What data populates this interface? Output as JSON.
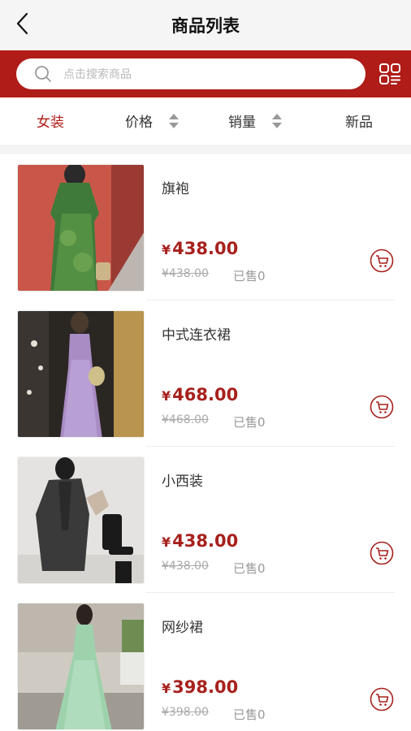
{
  "header": {
    "title": "商品列表",
    "back_icon": "chevron-left-icon"
  },
  "search": {
    "placeholder": "点击搜索商品",
    "icon": "search-icon",
    "scan_icon": "grid-list-icon"
  },
  "colors": {
    "brand": "#b01c18",
    "price": "#a7211d"
  },
  "filters": [
    {
      "label": "女装",
      "active": true
    },
    {
      "label": "价格",
      "sortable": true
    },
    {
      "label": "销量",
      "sortable": true
    },
    {
      "label": "新品"
    }
  ],
  "products": [
    {
      "name": "旗袍",
      "currency": "¥",
      "price": "438.00",
      "original_price": "¥438.00",
      "sold": "已售0",
      "image": "green qipao dress photo"
    },
    {
      "name": "中式连衣裙",
      "currency": "¥",
      "price": "468.00",
      "original_price": "¥468.00",
      "sold": "已售0",
      "image": "purple slip dress photo"
    },
    {
      "name": "小西装",
      "currency": "¥",
      "price": "438.00",
      "original_price": "¥438.00",
      "sold": "已售0",
      "image": "dark blazer photo"
    },
    {
      "name": "网纱裙",
      "currency": "¥",
      "price": "398.00",
      "original_price": "¥398.00",
      "sold": "已售0",
      "image": "mint tulle dress photo"
    }
  ]
}
